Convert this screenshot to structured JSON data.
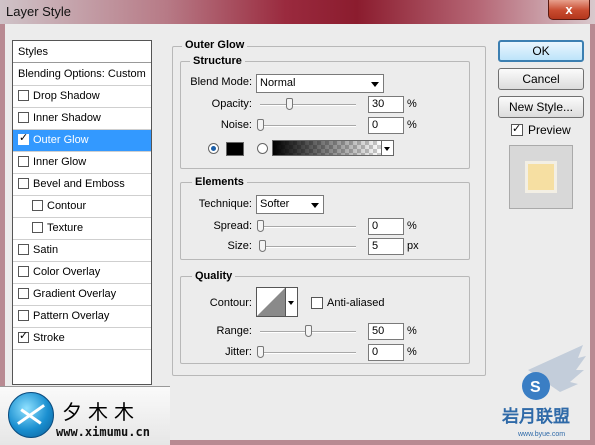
{
  "window": {
    "title": "Layer Style",
    "close_glyph": "x"
  },
  "styles_panel": {
    "header": "Styles",
    "items": [
      {
        "label": "Blending Options: Custom",
        "has_checkbox": false,
        "checked": false,
        "indent": false,
        "selected": false
      },
      {
        "label": "Drop Shadow",
        "has_checkbox": true,
        "checked": false,
        "indent": false,
        "selected": false
      },
      {
        "label": "Inner Shadow",
        "has_checkbox": true,
        "checked": false,
        "indent": false,
        "selected": false
      },
      {
        "label": "Outer Glow",
        "has_checkbox": true,
        "checked": true,
        "indent": false,
        "selected": true
      },
      {
        "label": "Inner Glow",
        "has_checkbox": true,
        "checked": false,
        "indent": false,
        "selected": false
      },
      {
        "label": "Bevel and Emboss",
        "has_checkbox": true,
        "checked": false,
        "indent": false,
        "selected": false
      },
      {
        "label": "Contour",
        "has_checkbox": true,
        "checked": false,
        "indent": true,
        "selected": false
      },
      {
        "label": "Texture",
        "has_checkbox": true,
        "checked": false,
        "indent": true,
        "selected": false
      },
      {
        "label": "Satin",
        "has_checkbox": true,
        "checked": false,
        "indent": false,
        "selected": false
      },
      {
        "label": "Color Overlay",
        "has_checkbox": true,
        "checked": false,
        "indent": false,
        "selected": false
      },
      {
        "label": "Gradient Overlay",
        "has_checkbox": true,
        "checked": false,
        "indent": false,
        "selected": false
      },
      {
        "label": "Pattern Overlay",
        "has_checkbox": true,
        "checked": false,
        "indent": false,
        "selected": false
      },
      {
        "label": "Stroke",
        "has_checkbox": true,
        "checked": true,
        "indent": false,
        "selected": false
      }
    ]
  },
  "outer_glow": {
    "title": "Outer Glow",
    "structure": {
      "title": "Structure",
      "blend_mode_label": "Blend Mode:",
      "blend_mode_value": "Normal",
      "opacity_label": "Opacity:",
      "opacity_value": "30",
      "opacity_fraction": 0.3,
      "opacity_unit": "%",
      "noise_label": "Noise:",
      "noise_value": "0",
      "noise_fraction": 0,
      "noise_unit": "%",
      "color_mode": "solid",
      "glow_color": "#000000"
    },
    "elements": {
      "title": "Elements",
      "technique_label": "Technique:",
      "technique_value": "Softer",
      "spread_label": "Spread:",
      "spread_value": "0",
      "spread_fraction": 0,
      "spread_unit": "%",
      "size_label": "Size:",
      "size_value": "5",
      "size_fraction": 0.02,
      "size_unit": "px"
    },
    "quality": {
      "title": "Quality",
      "contour_label": "Contour:",
      "anti_aliased_label": "Anti-aliased",
      "anti_aliased_checked": false,
      "range_label": "Range:",
      "range_value": "50",
      "range_fraction": 0.5,
      "range_unit": "%",
      "jitter_label": "Jitter:",
      "jitter_value": "0",
      "jitter_fraction": 0,
      "jitter_unit": "%"
    }
  },
  "actions": {
    "ok_label": "OK",
    "cancel_label": "Cancel",
    "new_style_label": "New Style...",
    "preview_label": "Preview",
    "preview_checked": true,
    "preview_fill": "#f6dfa2",
    "preview_border": "#f3efe4"
  },
  "watermark": {
    "brand_cn": "夕木木",
    "url": "www.ximumu.cn",
    "right_logo_text": "岩月联盟",
    "right_logo_url": "www.byue.com"
  },
  "colors": {
    "selection": "#3399ff",
    "title_accent": "#8b1c2e"
  }
}
